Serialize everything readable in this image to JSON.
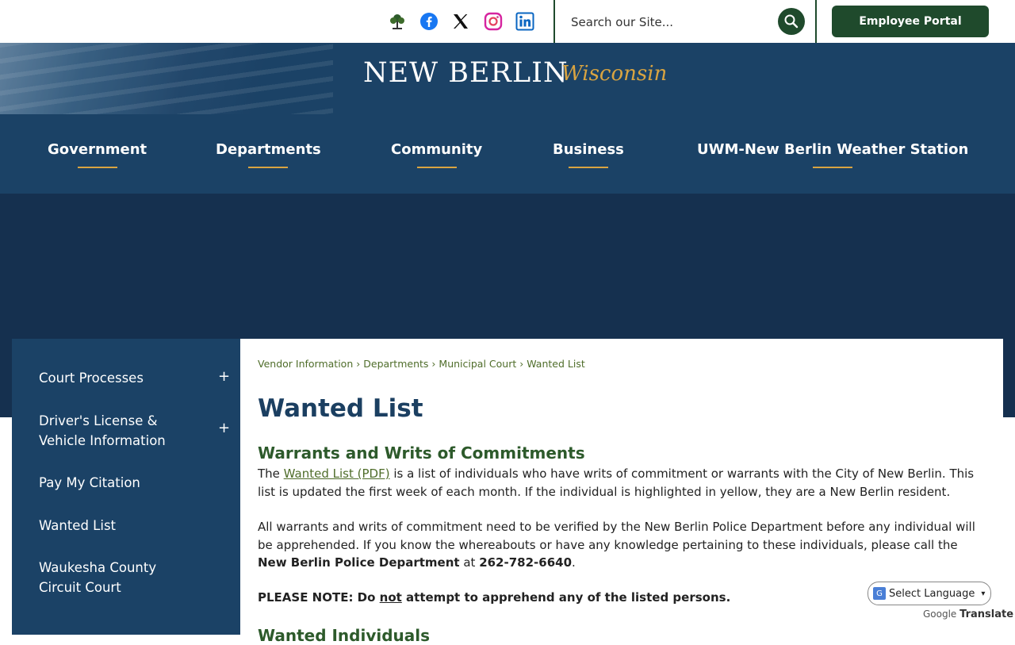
{
  "top_bar": {
    "social_icons": [
      "tree-icon",
      "facebook-icon",
      "x-icon",
      "instagram-icon",
      "linkedin-icon"
    ],
    "search": {
      "placeholder": "Search our Site..."
    },
    "employee_portal": "Employee Portal"
  },
  "header": {
    "logo_main": "NEW BERLIN",
    "logo_sub": "Wisconsin"
  },
  "nav": {
    "items": [
      "Government",
      "Departments",
      "Community",
      "Business",
      "UWM-New Berlin Weather Station"
    ]
  },
  "sidebar": {
    "items": [
      {
        "label": "Court Processes",
        "toggle": "+"
      },
      {
        "label": "Driver's License & Vehicle Information",
        "toggle": "+"
      },
      {
        "label": "Pay My Citation"
      },
      {
        "label": "Wanted List"
      },
      {
        "label": "Waukesha County Circuit Court"
      }
    ]
  },
  "breadcrumb": [
    "Vendor Information",
    "Departments",
    "Municipal Court",
    "Wanted List"
  ],
  "breadcrumb_sep": "›",
  "main": {
    "title": "Wanted List",
    "section_heading": "Warrants and Writs of Commitments",
    "p1_before": "The ",
    "p1_link": "Wanted List (PDF)",
    "p1_after": " is a list of individuals who have writs of commitment or warrants with the City of New Berlin. This list is updated the first week of each month.  If the individual is highlighted in yellow, they are a New Berlin resident.",
    "p2_text": "All warrants and writs of commitment need to be verified by the New Berlin Police Department before any individual will be apprehended. If you know the whereabouts or have any knowledge pertaining to these individuals, please call the ",
    "p2_bold": "New Berlin Police Department",
    "p2_at": " at ",
    "p2_phone": "262-782-6640",
    "p2_end": ".",
    "note_a": "PLEASE NOTE: Do ",
    "note_not": "not",
    "note_b": " attempt to apprehend any of the listed persons.",
    "section_heading_2": "Wanted Individuals"
  },
  "translate": {
    "select_label": "Select Language",
    "powered_by": "Google",
    "translate_label": "Translate"
  },
  "colors": {
    "navy": "#1b4266",
    "green": "#1f4a2c",
    "gold": "#d9a441"
  }
}
